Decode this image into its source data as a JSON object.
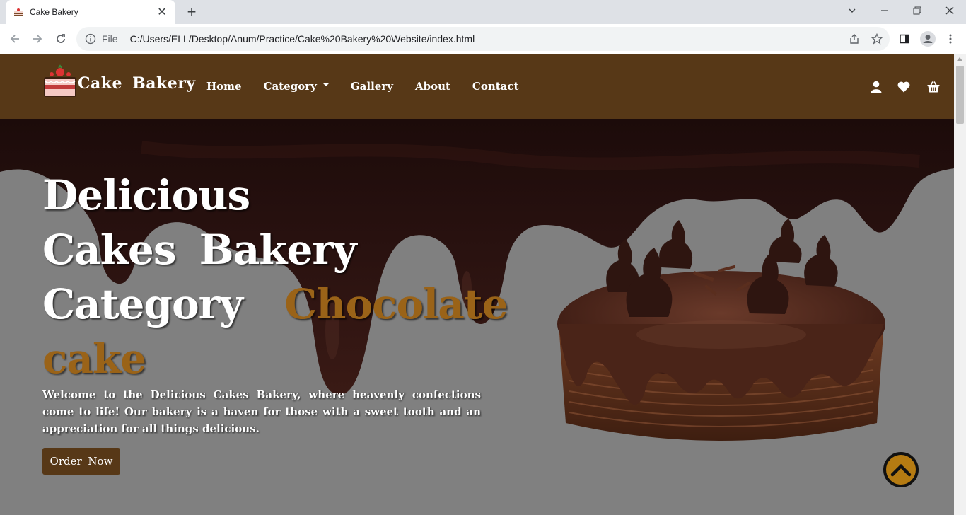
{
  "browser": {
    "tab_title": "Cake Bakery",
    "new_tab": "+",
    "omnibox_scheme": "File",
    "url": "C:/Users/ELL/Desktop/Anum/Practice/Cake%20Bakery%20Website/index.html"
  },
  "site": {
    "logo_text": "Cake Bakery",
    "menu": [
      "Home",
      "Category",
      "Gallery",
      "About",
      "Contact"
    ],
    "icons": [
      "user-icon",
      "heart-icon",
      "basket-icon"
    ]
  },
  "hero": {
    "title_line1": "Delicious",
    "title_line2": "Cakes Bakery",
    "title_line3_white": "Category",
    "title_line3_accent": "Chocolate",
    "title_line4_accent": "cake",
    "description": "Welcome to the Delicious Cakes Bakery, where heavenly confections come to life! Our bakery is a haven for those with a sweet tooth and an appreciation for all things delicious.",
    "order_button": "Order Now"
  },
  "colors": {
    "nav_bg": "#573817",
    "accent": "#9a6318",
    "back_to_top": "#b57b12"
  }
}
